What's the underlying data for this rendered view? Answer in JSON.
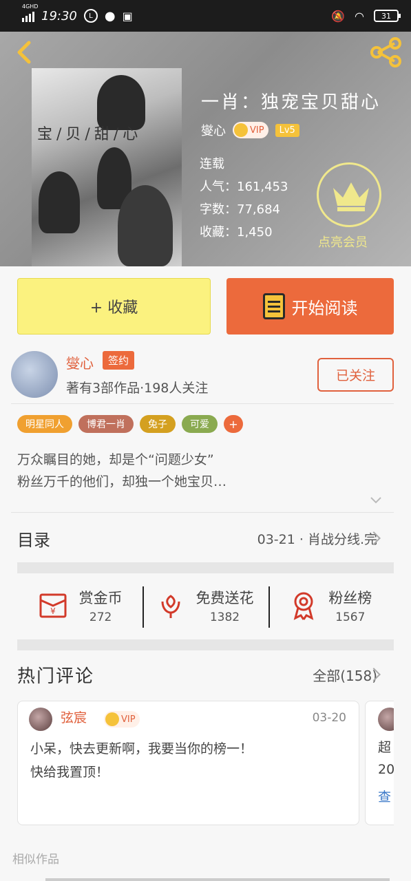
{
  "status_bar": {
    "network": "4GHD",
    "time": "19:30",
    "battery": "31"
  },
  "book": {
    "cover_title": "宝/贝/甜/心",
    "title": "一肖：独宠宝贝甜心",
    "author": "燮心",
    "vip_label": "VIP",
    "level": "Lv5",
    "status": "连载",
    "popularity_label": "人气：",
    "popularity": "161,453",
    "words_label": "字数：",
    "words": "77,684",
    "favorites_label": "收藏：",
    "favorites": "1,450",
    "member_label": "点亮会员"
  },
  "actions": {
    "favorite": "+ 收藏",
    "read": "开始阅读"
  },
  "author_info": {
    "name": "燮心",
    "signed": "签约",
    "stats": "著有3部作品·198人关注",
    "follow": "已关注"
  },
  "tags": [
    {
      "label": "明星同人",
      "color": "#f0a030"
    },
    {
      "label": "博君一肖",
      "color": "#c0705c"
    },
    {
      "label": "兔子",
      "color": "#d4a020"
    },
    {
      "label": "可爱",
      "color": "#8aaa50"
    }
  ],
  "tag_more": "+",
  "description": {
    "line1": "万众瞩目的她，却是个“问题少女”",
    "line2": "粉丝万千的他们，却独一个她宝贝…"
  },
  "toc": {
    "label": "目录",
    "latest": "03-21 · 肖战分线.完"
  },
  "stats": [
    {
      "label": "赏金币",
      "value": "272",
      "icon": "red-envelope-icon"
    },
    {
      "label": "免费送花",
      "value": "1382",
      "icon": "flower-icon"
    },
    {
      "label": "粉丝榜",
      "value": "1567",
      "icon": "medal-icon"
    }
  ],
  "comments": {
    "title": "热门评论",
    "all": "全部(158)",
    "items": [
      {
        "user": "弦宸",
        "vip": "VIP",
        "date": "03-20",
        "line1": "小呆，快去更新啊，我要当你的榜一！",
        "line2": "快给我置顶！"
      }
    ],
    "peek": {
      "line1": "超",
      "line2": "20",
      "line3": "查"
    }
  },
  "similar": "相似作品",
  "colors": {
    "accent": "#ec6a3c",
    "favorite_bg": "#fbf27f",
    "vip_gold": "#f0e88c"
  }
}
